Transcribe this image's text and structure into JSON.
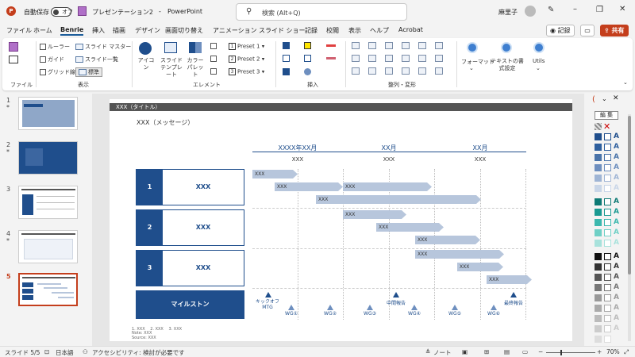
{
  "titlebar": {
    "autosave_label": "自動保存",
    "autosave_state": "オフ",
    "file_name": "プレゼンテーション2",
    "app_name": "PowerPoint",
    "search_placeholder": "検索 (Alt+Q)",
    "user_name": "麻里子"
  },
  "tabs": [
    "ファイル",
    "ホーム",
    "Benrie",
    "挿入",
    "描画",
    "デザイン",
    "画面切り替え",
    "アニメーション",
    "スライド ショー",
    "記録",
    "校閲",
    "表示",
    "ヘルプ",
    "Acrobat"
  ],
  "active_tab": "Benrie",
  "tab_actions": {
    "record": "記録",
    "share": "共有"
  },
  "ribbon": {
    "file_group": "ファイル",
    "view_group": "表示",
    "view_items": [
      "ルーラー",
      "ガイド",
      "グリッド線"
    ],
    "master_items": [
      "スライド マスター",
      "スライド一覧",
      "標準"
    ],
    "element_group": "エレメント",
    "icon_label": "アイコン",
    "template_label": "スライドテンプレート",
    "palette_label": "カラーパレット",
    "presets": [
      "Preset 1",
      "Preset 2",
      "Preset 3"
    ],
    "insert_group": "挿入",
    "arrange_group": "整列・変形",
    "format_label": "フォーマット",
    "text_settings_label": "テキストの書式設定",
    "utils_label": "Utils"
  },
  "thumbnails": [
    {
      "num": "1",
      "star": "*"
    },
    {
      "num": "2",
      "star": "*"
    },
    {
      "num": "3",
      "star": ""
    },
    {
      "num": "4",
      "star": "*"
    },
    {
      "num": "5",
      "star": ""
    }
  ],
  "slide": {
    "title": "XXX（タイトル）",
    "message": "XXX（メッセージ）",
    "headers": [
      "XXXX年XX月",
      "XX月",
      "XX月"
    ],
    "subheaders": [
      "XXX",
      "XXX",
      "XXX"
    ],
    "rows": [
      {
        "num": "1",
        "label": "XXX"
      },
      {
        "num": "2",
        "label": "XXX"
      },
      {
        "num": "3",
        "label": "XXX"
      }
    ],
    "bar_label": "XXX",
    "milestone_label": "マイルストン",
    "milestones": [
      "キックオフMTG",
      "WG①",
      "WG②",
      "WG③",
      "中間報告",
      "WG④",
      "WG⑤",
      "WG⑥",
      "最終報告"
    ],
    "notes": [
      "1. XXX　 2. XXX　 3. XXX",
      "Note: XXX",
      "Source: XXX"
    ]
  },
  "right_panel": {
    "edit_label": "編 集"
  },
  "status": {
    "slide_counter": "スライド 5/5",
    "language": "日本語",
    "accessibility": "アクセシビリティ: 検討が必要です",
    "notes": "ノート",
    "zoom": "70%"
  }
}
